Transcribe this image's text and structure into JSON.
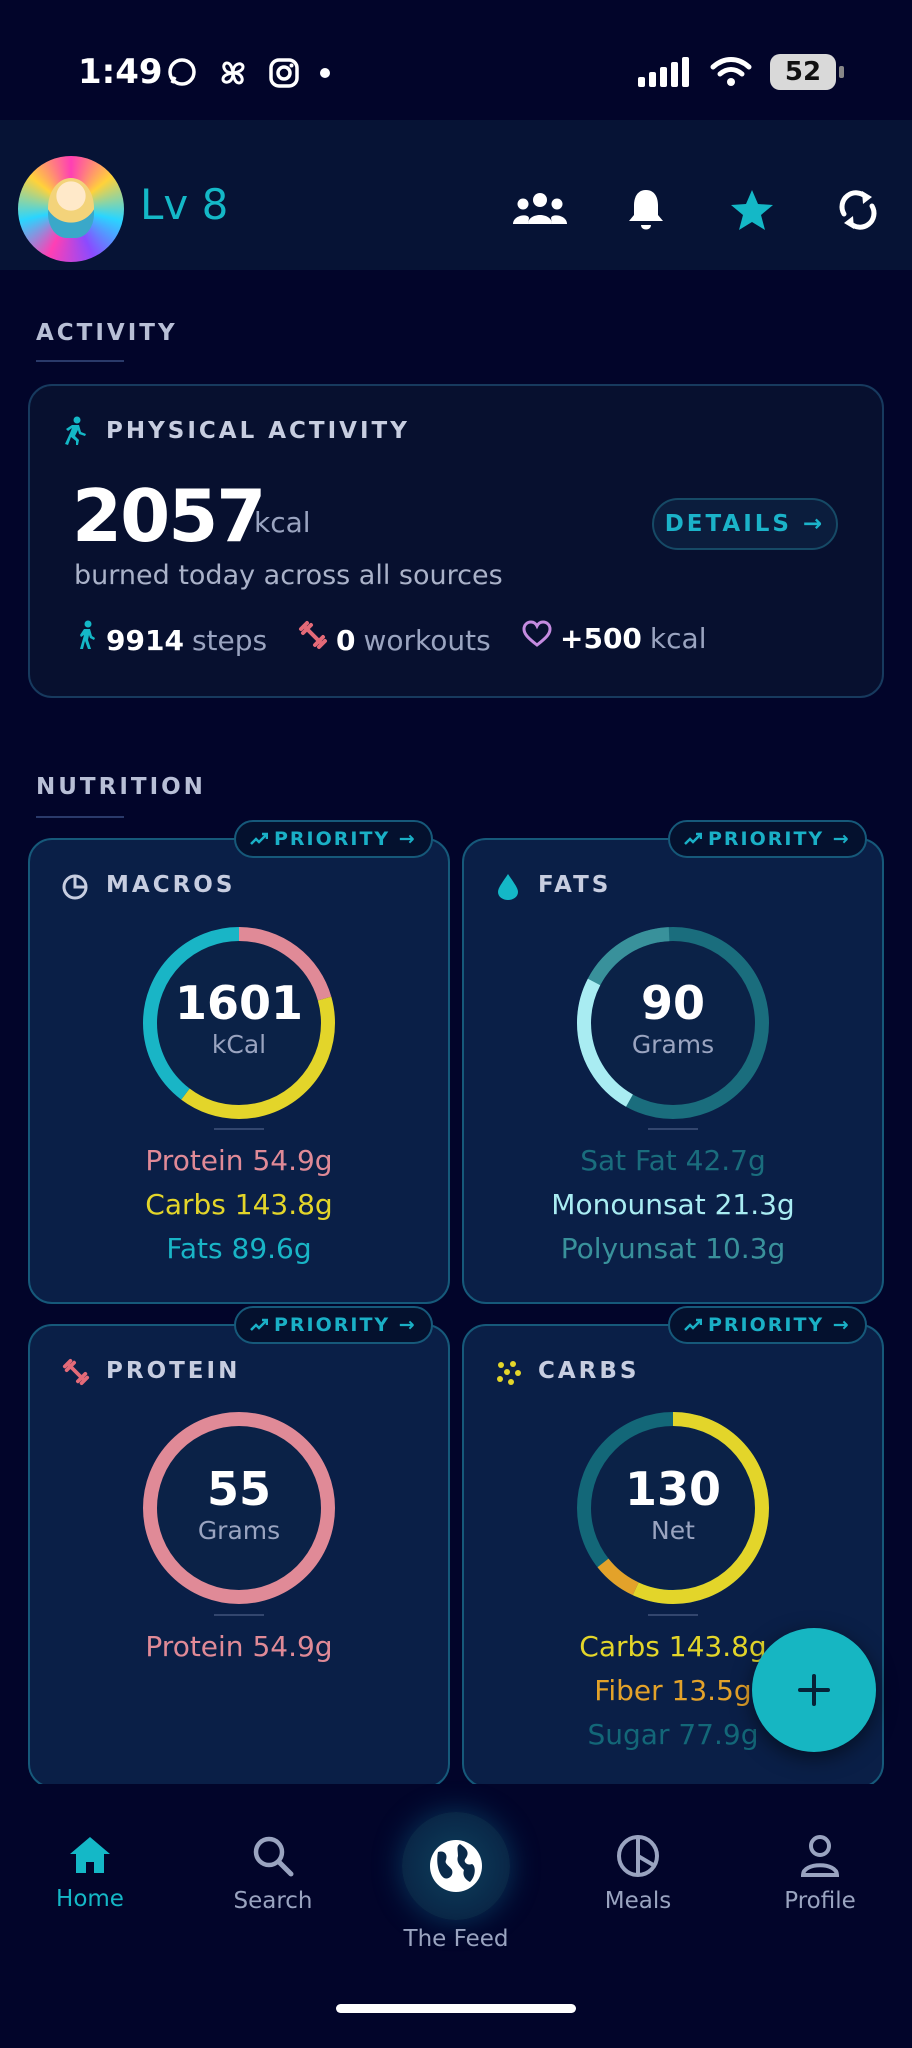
{
  "status_bar": {
    "time": "1:49",
    "battery": "52"
  },
  "header": {
    "level": "Lv 8"
  },
  "activity": {
    "section_title": "ACTIVITY",
    "card_title": "PHYSICAL ACTIVITY",
    "kcal": "2057",
    "kcal_unit": "kcal",
    "burned_text": "burned today across all sources",
    "details_label": "DETAILS →",
    "steps_value": "9914",
    "steps_label": "steps",
    "workouts_value": "0",
    "workouts_label": "workouts",
    "bonus_value": "+500",
    "bonus_label": "kcal"
  },
  "nutrition": {
    "section_title": "NUTRITION",
    "priority_label": "PRIORITY →",
    "macros": {
      "title": "MACROS",
      "value": "1601",
      "unit": "kCal",
      "lines": [
        "Protein 54.9g",
        "Carbs 143.8g",
        "Fats 89.6g"
      ],
      "colors": [
        "#e08a97",
        "#e3d52a",
        "#19b5c6"
      ]
    },
    "fats": {
      "title": "FATS",
      "value": "90",
      "unit": "Grams",
      "lines": [
        "Sat Fat 42.7g",
        "Monounsat 21.3g",
        "Polyunsat 10.3g"
      ],
      "colors": [
        "#1a6d7d",
        "#a9ecf2",
        "#39919b"
      ]
    },
    "protein": {
      "title": "PROTEIN",
      "value": "55",
      "unit": "Grams",
      "lines": [
        "Protein 54.9g"
      ],
      "colors": [
        "#e08a97"
      ]
    },
    "carbs": {
      "title": "CARBS",
      "value": "130",
      "unit": "Net",
      "lines": [
        "Carbs 143.8g",
        "Fiber 13.5g",
        "Sugar 77.9g"
      ],
      "colors": [
        "#e3d52a",
        "#e3a22a",
        "#136778"
      ]
    }
  },
  "nav": {
    "items": [
      {
        "label": "Home"
      },
      {
        "label": "Search"
      },
      {
        "label": "The Feed"
      },
      {
        "label": "Meals"
      },
      {
        "label": "Profile"
      }
    ]
  }
}
